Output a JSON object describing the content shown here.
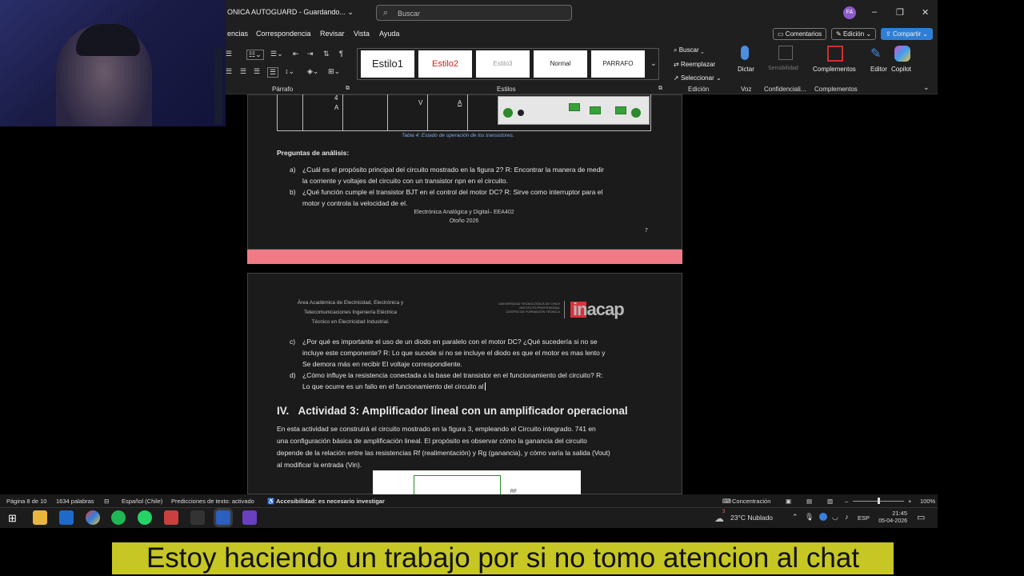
{
  "window": {
    "title": "ONICA AUTOGUARD - Guardando...",
    "search_placeholder": "Buscar",
    "avatar_initials": "FA",
    "minimize": "–",
    "restore": "❐",
    "close": "✕"
  },
  "menu": {
    "items": [
      "encias",
      "Correspondencia",
      "Revisar",
      "Vista",
      "Ayuda"
    ],
    "comments": "Comentarios",
    "editing": "Edición",
    "share": "Compartir"
  },
  "ribbon": {
    "groups": {
      "paragraph": "Párrafo",
      "styles": "Estilos",
      "editing": "Edición",
      "voice": "Voz",
      "confidentiality": "Confidenciali...",
      "addins": "Complementos"
    },
    "styles": [
      "Estilo1",
      "Estilo2",
      "Estilo3",
      "Normal",
      "PARRAFO"
    ],
    "find": "Buscar",
    "replace": "Reemplazar",
    "select": "Seleccionar",
    "dictate": "Dictar",
    "sensitivity": "Sensibilidad",
    "addins": "Complementos",
    "editor": "Editor",
    "copilot": "Copilot"
  },
  "page1": {
    "cell_letters": [
      "4",
      "A",
      "V",
      "A"
    ],
    "caption": "Tabla 4: Estado de operación de los transistores.",
    "heading": "Preguntas de análisis:",
    "qa_label": "a)",
    "qa_line1": "¿Cuál es el propósito principal del circuito mostrado en la figura 2? R: Encontrar la manera de medir",
    "qa_line2": "la corriente y voltajes del circuito con un transistor npn en el circuito.",
    "qb_label": "b)",
    "qb_line1": "¿Qué función cumple el transistor BJT en el control del motor DC? R: Sirve como interruptor para el",
    "qb_line2": "motor y controla la velocidad de el.",
    "footer1": "Electrónica Analógica y Digital– EEA402",
    "footer2": "Otoño 2026",
    "page_number": "7"
  },
  "page2": {
    "header_line1": "Área Académica  de Electricidad, Electrónica y",
    "header_line2": "Telecomunicaciones Ingeniería Eléctrica",
    "header_line3": "Técnico en Electricidad Industrial.",
    "logo_small1": "UNIVERSIDAD TECNOLÓGICA DE CHILE",
    "logo_small2": "INSTITUTO PROFESIONAL",
    "logo_small3": "CENTRO DE FORMACIÓN TÉCNICA",
    "logo_text": "inacap",
    "qc_label": "c)",
    "qc_line1": "¿Por qué es importante el uso de un diodo en paralelo con el motor DC? ¿Qué sucedería si no se",
    "qc_line2": "incluye este componente?  R: Lo que sucede si no se incluye el diodo es que el motor es mas lento y",
    "qc_line3": "Se demora más en recibir El voltaje correspondiente.",
    "qd_label": "d)",
    "qd_line1": "¿Cómo influye la resistencia conectada a la base del transistor en el funcionamiento del circuito? R:",
    "qd_line2": "Lo que ocurre es un fallo en el funcionamiento del circuito al",
    "section_number": "IV.",
    "section_title": "Actividad 3: Amplificador lineal con un amplificador operacional",
    "para_line1": "En esta actividad se construirá el circuito mostrado en la figura 3, empleando el Circuito integrado. 741 en",
    "para_line2": "una configuración básica de amplificación lineal. El propósito es observar cómo la ganancia del circuito",
    "para_line3": "depende de la relación entre las resistencias Rf (realimentación) y Rg (ganancia), y cómo varía la salida (Vout)",
    "para_line4": "al modificar la entrada (Vin).",
    "fig_label": "RF"
  },
  "status": {
    "page": "Página 8 de 10",
    "words": "1634 palabras",
    "language": "Español (Chile)",
    "predictions": "Predicciones de texto: activado",
    "accessibility": "Accesibilidad: es necesario investigar",
    "focus": "Concentración",
    "zoom_minus": "–",
    "zoom_plus": "+",
    "zoom": "100%"
  },
  "taskbar": {
    "weather_badge": "3",
    "weather": "23°C  Nublado",
    "lang": "ESP",
    "time": "21:45",
    "date": "05-04-2026"
  },
  "subtitle": "Estoy haciendo un trabajo por si no tomo atencion al chat",
  "colors": {
    "accent_pink": "#f07a86",
    "share_blue": "#2f7fd6",
    "subtitle_bg": "#c6c625"
  }
}
